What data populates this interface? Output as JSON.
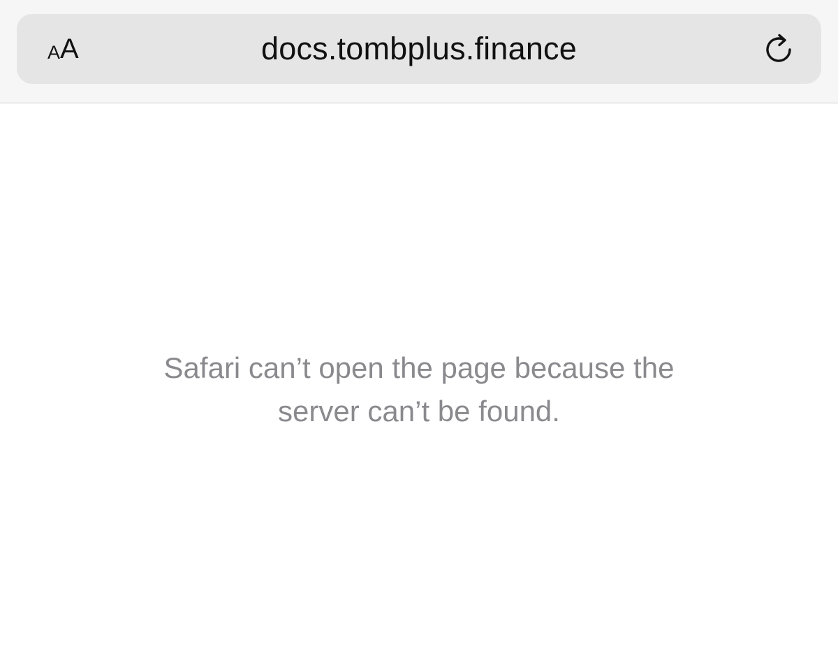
{
  "toolbar": {
    "reader_small": "A",
    "reader_large": "A",
    "url": "docs.tombplus.finance",
    "reader_icon": "text-size-icon",
    "reload_icon": "reload-icon"
  },
  "content": {
    "error_line_1": "Safari can’t open the page because the",
    "error_line_2": "server can’t be found."
  },
  "colors": {
    "toolbar_bg": "#f6f6f6",
    "address_bar_bg": "#e5e5e5",
    "error_text": "#8a8a8e"
  }
}
